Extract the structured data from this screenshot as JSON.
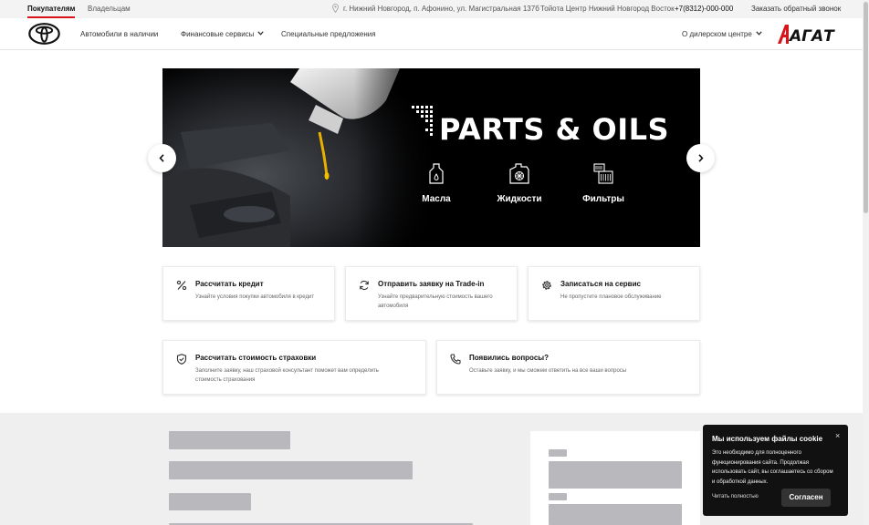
{
  "topbar": {
    "tab_buyers": "Покупателям",
    "tab_owners": "Владельцам",
    "address": "г. Нижний Новгород, п. Афонино, ул. Магистральная 137б",
    "dealer": "Тойота Центр Нижний Новгород Восток",
    "phone": "+7(8312)-000-000",
    "callback": "Заказать обратный звонок"
  },
  "header": {
    "nav_cars": "Автомобили в наличии",
    "nav_finance": "Финансовые сервисы",
    "nav_offers": "Специальные предложения",
    "nav_about": "О дилерском центре"
  },
  "banner": {
    "title": "PARTS & OILS",
    "categories": [
      "Масла",
      "Жидкости",
      "Фильтры"
    ]
  },
  "cards": [
    {
      "title": "Рассчитать кредит",
      "desc": "Узнайте условия покупки автомобиля в кредит",
      "icon": "percent-icon"
    },
    {
      "title": "Отправить заявку на Trade-in",
      "desc": "Узнайте предварительную стоимость вашего автомобиля",
      "icon": "refresh-icon"
    },
    {
      "title": "Записаться на сервис",
      "desc": "Не пропустите плановое обслуживание",
      "icon": "gear-icon"
    },
    {
      "title": "Рассчитать стоимость страховки",
      "desc": "Заполните заявку, наш страховой консультант поможет вам определить стоимость страхования",
      "icon": "shield-check-icon"
    },
    {
      "title": "Появились вопросы?",
      "desc": "Оставьте заявку, и мы сможем ответить на все ваши вопросы",
      "icon": "phone-icon"
    }
  ],
  "cookie": {
    "title": "Мы используем файлы cookie",
    "text": "Это необходимо для полноценного функционирования сайта. Продолжая использовать сайт, вы соглашаетесь со сбором и обработкой данных.",
    "read_more": "Читать полностью",
    "accept": "Согласен",
    "close": "×"
  },
  "colors": {
    "accent": "#d7141a",
    "banner_bg": "#000000",
    "skeleton": "#b8b8bd",
    "section_bg": "#efefef"
  }
}
